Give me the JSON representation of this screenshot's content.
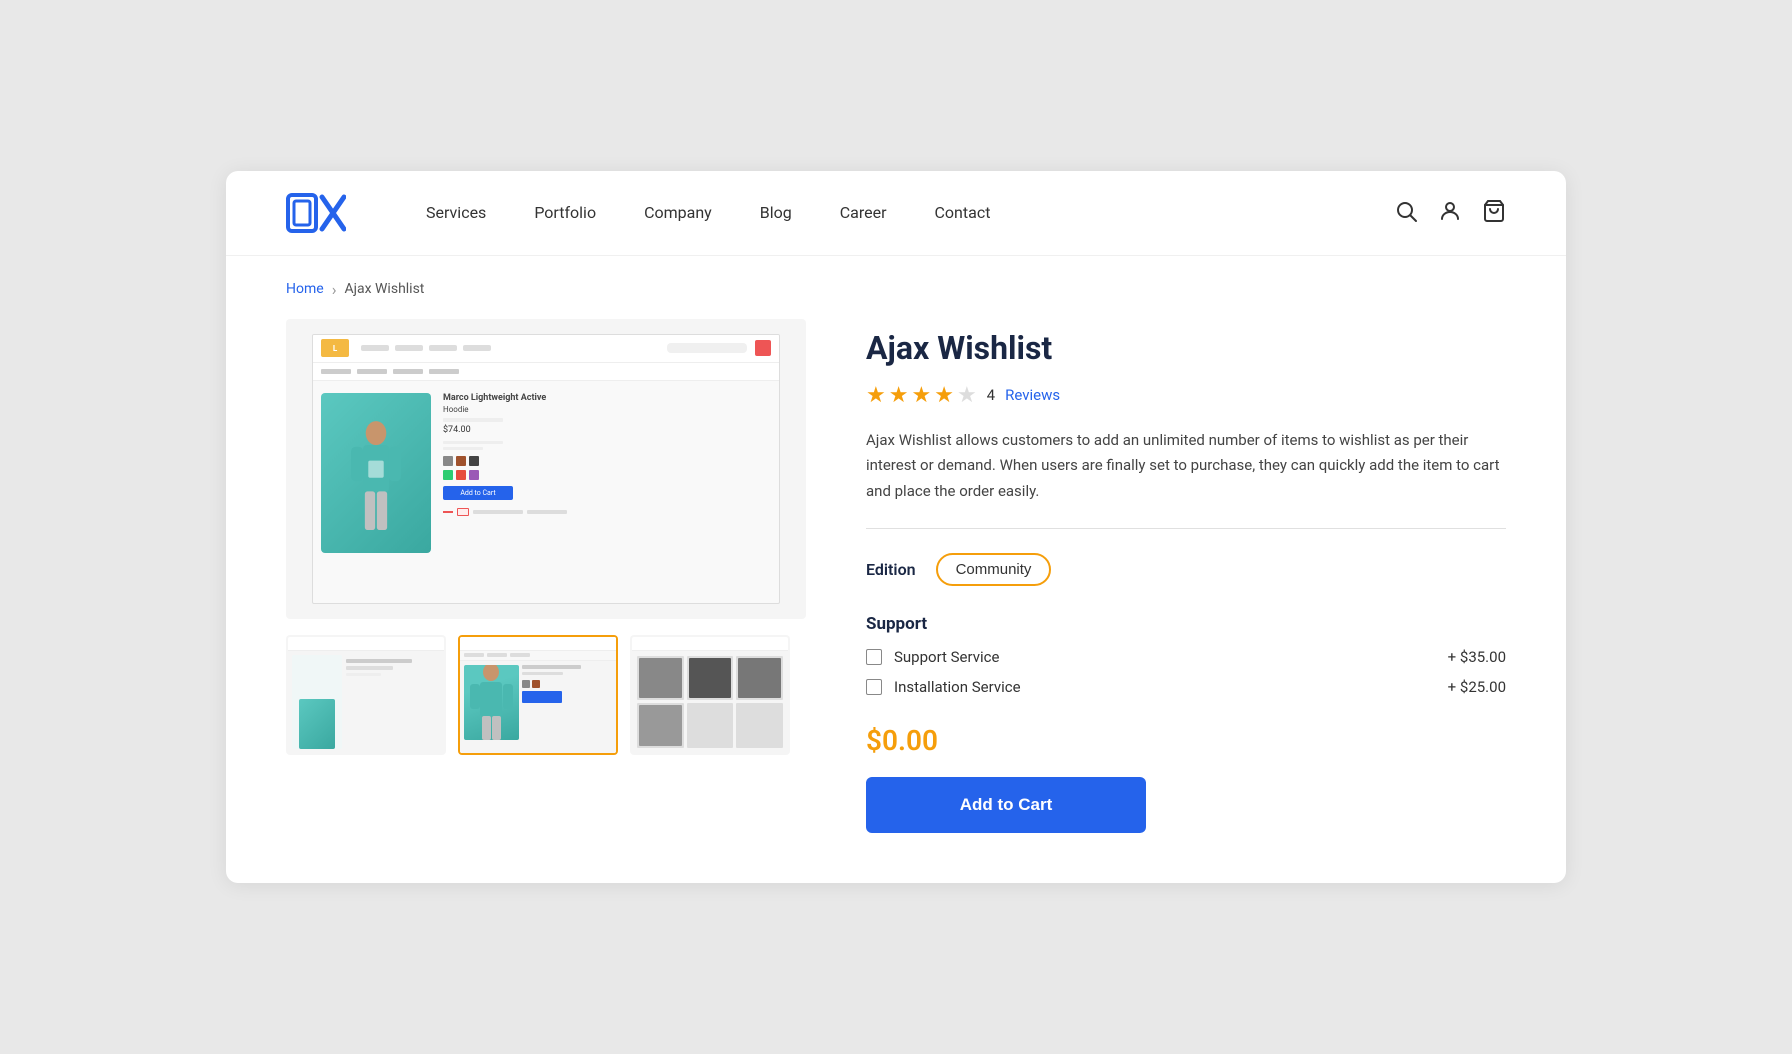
{
  "header": {
    "logo_text": "OX",
    "nav": {
      "items": [
        "Services",
        "Portfolio",
        "Company",
        "Blog",
        "Career",
        "Contact"
      ]
    }
  },
  "breadcrumb": {
    "home": "Home",
    "separator": "›",
    "current": "Ajax Wishlist"
  },
  "product": {
    "title": "Ajax Wishlist",
    "rating": {
      "value": 4,
      "max": 5,
      "count": "4",
      "reviews_label": "Reviews"
    },
    "description": "Ajax Wishlist allows customers to add an unlimited number of items to wishlist as per their interest or demand. When users are finally set to purchase, they can quickly add the item to cart and place the order easily.",
    "edition": {
      "label": "Edition",
      "value": "Community"
    },
    "support": {
      "title": "Support",
      "options": [
        {
          "name": "Support Service",
          "price": "+ $35.00"
        },
        {
          "name": "Installation Service",
          "price": "+ $25.00"
        }
      ]
    },
    "price": "$0.00",
    "add_to_cart": "Add to Cart"
  }
}
